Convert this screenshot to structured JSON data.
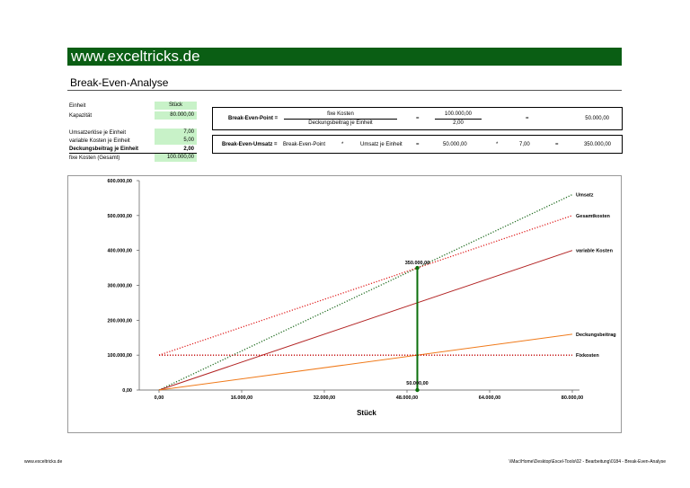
{
  "header": {
    "site": "www.exceltricks.de",
    "title": "Break-Even-Analyse"
  },
  "inputs": {
    "einheit": {
      "label": "Einheit",
      "value": "Stück"
    },
    "kapazitaet": {
      "label": "Kapazität",
      "value": "80.000,00"
    },
    "umsatzerloese": {
      "label": "Umsatzerlöse je Einheit",
      "value": "7,00"
    },
    "variable_kosten": {
      "label": "variable Kosten je Einheit",
      "value": "5,00"
    },
    "deckungsbeitrag": {
      "label": "Deckungsbeitrag je Einheit",
      "value": "2,00"
    },
    "fixe_kosten": {
      "label": "fixe Kosten (Gesamt)",
      "value": "100.000,00"
    }
  },
  "bep_box": {
    "label": "Break-Even-Point =",
    "numerator": "fixe Kosten",
    "denominator": "Deckungsbeitrag je Einheit",
    "eq1": "=",
    "num_value": "100.000,00",
    "den_value": "2,00",
    "eq2": "=",
    "result": "50.000,00"
  },
  "beu_box": {
    "label": "Break-Even-Umsatz =",
    "term1": "Break-Even-Point",
    "op1": "*",
    "term2": "Umsatz je Einheit",
    "eq1": "=",
    "value1": "50.000,00",
    "op2": "*",
    "value2": "7,00",
    "eq2": "=",
    "result": "350.000,00"
  },
  "chart_data": {
    "type": "line",
    "xlabel": "Stück",
    "ylabel": "",
    "xlim": [
      0,
      80000
    ],
    "ylim": [
      0,
      600000
    ],
    "x_ticks": [
      0,
      16000,
      32000,
      48000,
      64000,
      80000
    ],
    "x_tick_labels": [
      "0,00",
      "16.000,00",
      "32.000,00",
      "48.000,00",
      "64.000,00",
      "80.000,00"
    ],
    "y_ticks": [
      0,
      100000,
      200000,
      300000,
      400000,
      500000,
      600000
    ],
    "y_tick_labels": [
      "0,00",
      "100.000,00",
      "200.000,00",
      "300.000,00",
      "400.000,00",
      "500.000,00",
      "600.000,00"
    ],
    "series": [
      {
        "name": "Umsatz",
        "color": "#1f6b1f",
        "style": "dotted",
        "points": [
          [
            0,
            0
          ],
          [
            80000,
            560000
          ]
        ]
      },
      {
        "name": "Gesamtkosten",
        "color": "#e02020",
        "style": "dotted",
        "points": [
          [
            0,
            100000
          ],
          [
            80000,
            500000
          ]
        ]
      },
      {
        "name": "variable Kosten",
        "color": "#b22222",
        "style": "solid",
        "points": [
          [
            0,
            0
          ],
          [
            80000,
            400000
          ]
        ]
      },
      {
        "name": "Deckungsbeitrag",
        "color": "#f07a1a",
        "style": "solid",
        "points": [
          [
            0,
            0
          ],
          [
            80000,
            160000
          ]
        ]
      },
      {
        "name": "Fixkosten",
        "color": "#c00000",
        "style": "dotted",
        "points": [
          [
            0,
            100000
          ],
          [
            80000,
            100000
          ]
        ]
      }
    ],
    "break_even": {
      "x": 50000,
      "y": 350000,
      "color": "#0a6e0a",
      "label_top": "350.000,00",
      "label_bottom": "50.000,00"
    }
  },
  "footer": {
    "left": "www.exceltricks.de",
    "right": "\\\\Mac\\Home\\Desktop\\Excel-Tools\\02 - Bearbeitung\\0184 - Break-Even-Analyse"
  }
}
